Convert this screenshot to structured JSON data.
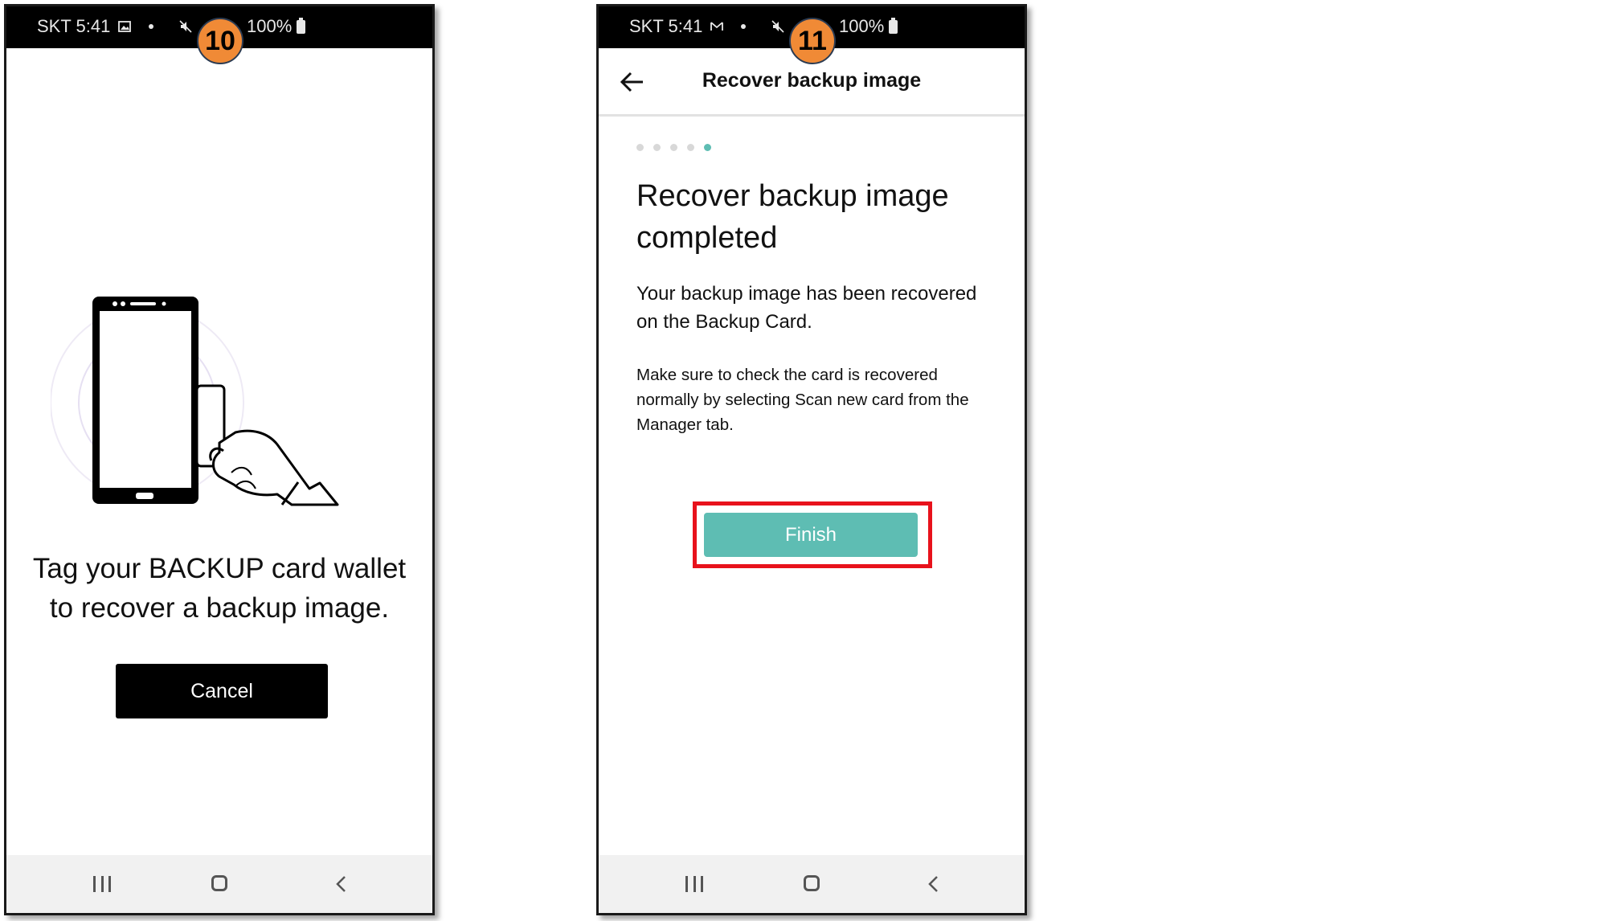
{
  "screen_10": {
    "step_number": "10",
    "status": {
      "carrier_time": "SKT 5:41",
      "battery": "100%"
    },
    "message_line1": "Tag your BACKUP card wallet",
    "message_line2": "to recover a backup image.",
    "cancel_label": "Cancel"
  },
  "screen_11": {
    "step_number": "11",
    "status": {
      "carrier_time": "SKT 5:41",
      "battery": "100%"
    },
    "header_title": "Recover backup image",
    "progress": {
      "total_steps": 5,
      "current_step": 5
    },
    "title_line1": "Recover backup image",
    "title_line2": "completed",
    "description": "Your backup image has been recovered on the Backup Card.",
    "note": "Make sure to check the card is recovered normally by selecting Scan new card from the Manager tab.",
    "finish_label": "Finish"
  },
  "colors": {
    "accent": "#5ebdb3",
    "highlight": "#e8121c",
    "badge": "#f08a36"
  },
  "icons": {
    "status_left_screen_10": "gallery-icon",
    "status_left_screen_11": "gmail-icon",
    "status_right": "mute-icon",
    "nav": [
      "recents-icon",
      "home-icon",
      "back-icon"
    ]
  }
}
